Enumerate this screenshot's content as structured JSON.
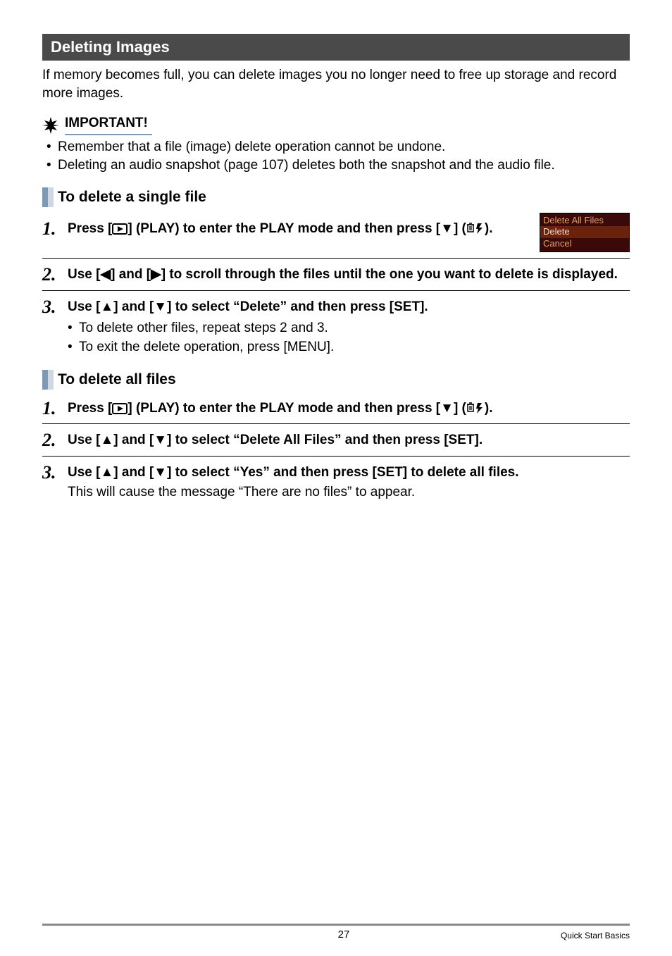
{
  "section_title": "Deleting Images",
  "intro": "If memory becomes full, you can delete images you no longer need to free up storage and record more images.",
  "important_label": "IMPORTANT!",
  "important_bullets": [
    "Remember that a file (image) delete operation cannot be undone.",
    "Deleting an audio snapshot (page 107) deletes both the snapshot and the audio file."
  ],
  "sub1_title": "To delete a single file",
  "step1a_pre": "Press [",
  "step1a_mid": "] (PLAY) to enter the PLAY mode and then press [",
  "step1a_arrow": "▼",
  "step1a_tail": "] (",
  "step1a_end": ").",
  "screenshot": {
    "line1": "Delete All Files",
    "line2": "Delete",
    "line3": "Cancel"
  },
  "step2a_pre": "Use [",
  "step2a_l": "◀",
  "step2a_mid": "] and [",
  "step2a_r": "▶",
  "step2a_end": "] to scroll through the files until the one you want to delete is displayed.",
  "step3a_pre": "Use [",
  "step3a_u": "▲",
  "step3a_mid": "] and [",
  "step3a_d": "▼",
  "step3a_end": "] to select “Delete” and then press [SET].",
  "step3a_bullets": [
    "To delete other files, repeat steps 2 and 3.",
    "To exit the delete operation, press [MENU]."
  ],
  "sub2_title": "To delete all files",
  "step1b_pre": "Press [",
  "step1b_mid": "] (PLAY) to enter the PLAY mode and then press [",
  "step1b_arrow": "▼",
  "step1b_tail": "] (",
  "step1b_end": ").",
  "step2b_pre": "Use [",
  "step2b_u": "▲",
  "step2b_mid": "] and [",
  "step2b_d": "▼",
  "step2b_end": "] to select “Delete All Files” and then press [SET].",
  "step3b_pre": "Use [",
  "step3b_u": "▲",
  "step3b_mid": "] and [",
  "step3b_d": "▼",
  "step3b_end": "] to select “Yes” and then press [SET] to delete all files.",
  "step3b_note": "This will cause the message “There are no files” to appear.",
  "page_number": "27",
  "footer_text": "Quick Start Basics",
  "nums": {
    "n1": "1.",
    "n2": "2.",
    "n3": "3."
  }
}
